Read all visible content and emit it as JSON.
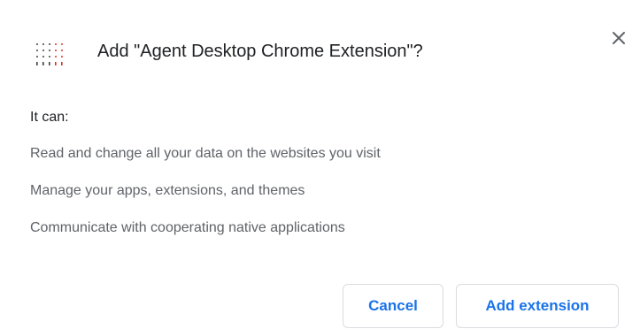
{
  "dialog": {
    "title": "Add \"Agent Desktop Chrome Extension\"?",
    "close_icon": "close-icon",
    "extension_icon": "agent-desktop-logo-icon",
    "lead": "It can:",
    "permissions": [
      "Read and change all your data on the websites you visit",
      "Manage your apps, extensions, and themes",
      "Communicate with cooperating native applications"
    ],
    "buttons": {
      "cancel_label": "Cancel",
      "add_label": "Add extension"
    }
  },
  "colors": {
    "accent": "#1a73e8",
    "title_text": "#202124",
    "secondary_text": "#5f6368",
    "button_border": "#dadce0",
    "logo_red": "#d93025",
    "logo_dark": "#3c4043"
  }
}
